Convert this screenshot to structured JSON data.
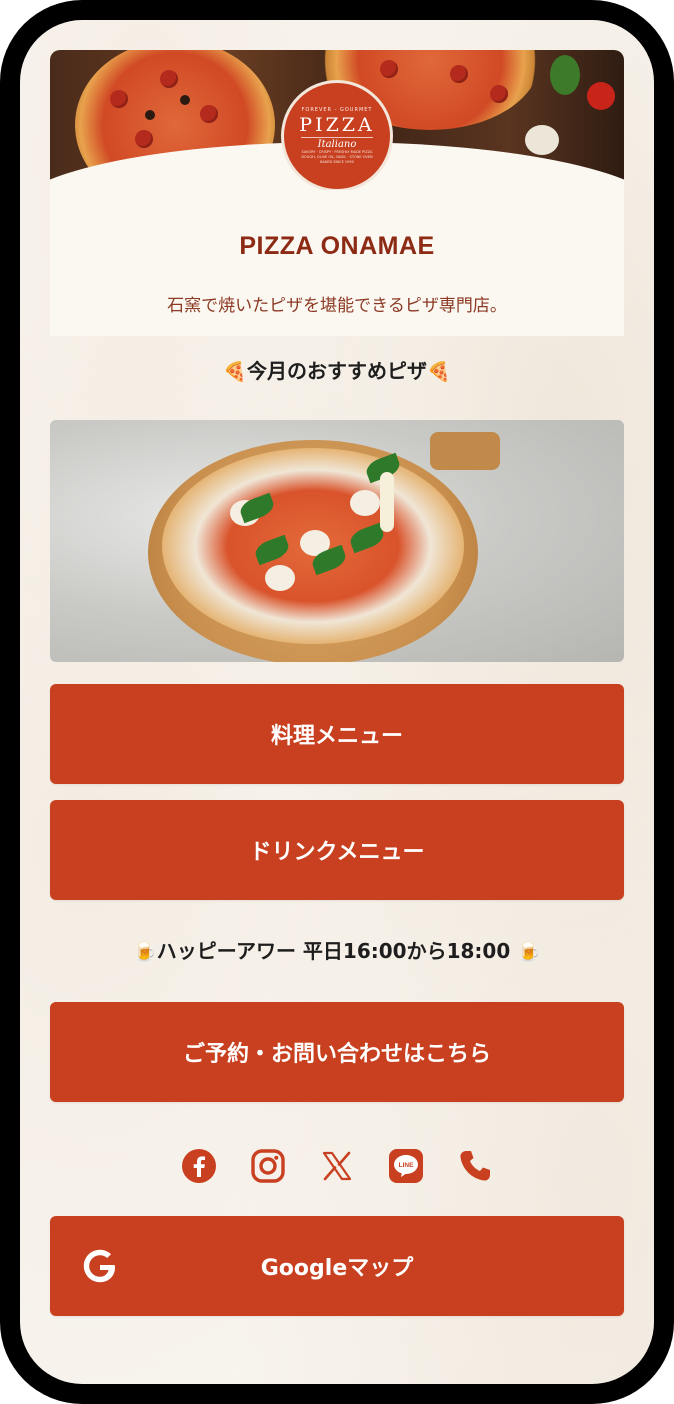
{
  "header": {
    "logo": {
      "top_text": "FOREVER - GOURMET",
      "main_text": "PIZZA",
      "script_text": "Italiano",
      "fine_print": "SAVORY · CRISPY · FRESHLY MADE PIZZA DOUGH, OLIVE OIL, BASIL · STONE OVEN BAKED SINCE 1990"
    },
    "shop_name": "PIZZA ONAMAE",
    "tagline": "石窯で焼いたピザを堪能できるピザ専門店。"
  },
  "recommend": {
    "emoji": "🍕",
    "heading": "今月のおすすめピザ"
  },
  "buttons": {
    "food_menu": "料理メニュー",
    "drink_menu": "ドリンクメニュー",
    "contact": "ご予約・お問い合わせはこちら",
    "google_map": "Googleマップ"
  },
  "happy_hour": {
    "emoji": "🍺",
    "text": "ハッピーアワー 平日16:00から18:00"
  },
  "social": [
    "facebook-icon",
    "instagram-icon",
    "x-icon",
    "line-icon",
    "phone-icon"
  ],
  "colors": {
    "accent": "#c8401f",
    "shop_name": "#8c2a14",
    "tagline": "#8c3a24",
    "background": "#f9f6f1"
  }
}
